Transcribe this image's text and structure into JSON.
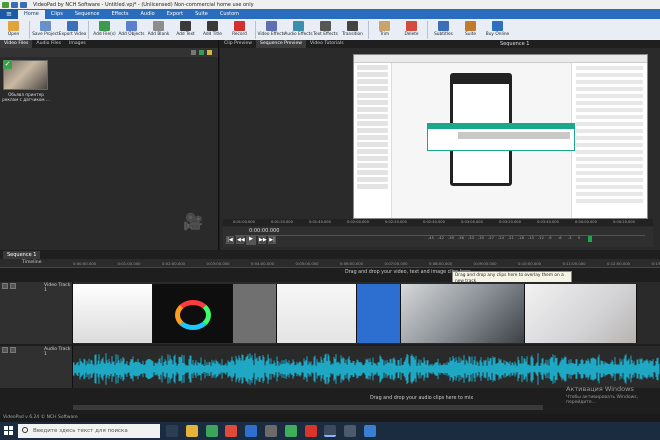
{
  "window": {
    "title": "VideoPad by NCH Software - Untitled.vpj* - (Unlicensed) Non-commercial home use only"
  },
  "menu": {
    "tabs": [
      "Home",
      "Clips",
      "Sequence",
      "Effects",
      "Audio",
      "Export",
      "Suite",
      "Custom"
    ]
  },
  "ribbon": {
    "buttons": [
      {
        "label": "Open",
        "color": "#e0a43a"
      },
      {
        "label": "Save Project",
        "color": "#6b8fc9"
      },
      {
        "label": "Export Video",
        "color": "#3b6fb8"
      },
      {
        "label": "Add File(s)",
        "color": "#3a9b4c"
      },
      {
        "label": "Add Objects",
        "color": "#5a7fd0"
      },
      {
        "label": "Add Blank",
        "color": "#8d8d8d"
      },
      {
        "label": "Add Text",
        "color": "#3a3a3a"
      },
      {
        "label": "Add Title",
        "color": "#3a3a3a"
      },
      {
        "label": "Record",
        "color": "#d0312d"
      },
      {
        "label": "Video Effects",
        "color": "#5f6fb0"
      },
      {
        "label": "Audio Effects",
        "color": "#3a8fb0"
      },
      {
        "label": "Text Effects",
        "color": "#555555"
      },
      {
        "label": "Transition",
        "color": "#444444"
      },
      {
        "label": "Trim",
        "color": "#c9a36b"
      },
      {
        "label": "Delete",
        "color": "#d24b3c"
      },
      {
        "label": "Subtitles",
        "color": "#3a6fb8"
      },
      {
        "label": "Suite",
        "color": "#c07b2c"
      },
      {
        "label": "Buy Online",
        "color": "#2f6fc0"
      }
    ]
  },
  "left_panel": {
    "tabs": [
      "Video Files",
      "Audio Files",
      "Images"
    ],
    "clip_label": "Обьявл принтер реклам с датчиком ..."
  },
  "preview": {
    "tabs": [
      "Clip Preview",
      "Sequence Preview",
      "Video Tutorials"
    ],
    "sequence_label": "Sequence 1",
    "timecode": "0:00:00.000",
    "ruler_ticks": [
      "0:01:00.000",
      "0:01:20.000",
      "0:01:40.000",
      "0:02:00.000",
      "0:02:20.000",
      "0:02:40.000",
      "0:03:00.000",
      "0:03:20.000",
      "0:03:40.000",
      "0:04:00.000",
      "0:04:20.000"
    ],
    "meter_ticks": [
      "-45",
      "-42",
      "-39",
      "-36",
      "-33",
      "-30",
      "-27",
      "-24",
      "-21",
      "-18",
      "-15",
      "-12",
      "-9",
      "-6",
      "-3",
      "0"
    ],
    "controls": [
      "|◀",
      "◀◀",
      "▶",
      "▶▶",
      "▶|"
    ]
  },
  "timeline": {
    "tab": "Sequence 1",
    "ruler_label": "Timeline",
    "ticks": [
      "0:00:00.000",
      "0:01:00.000",
      "0:02:00.000",
      "0:03:00.000",
      "0:04:00.000",
      "0:05:00.000",
      "0:06:00.000",
      "0:07:00.000",
      "0:08:00.000",
      "0:09:00.000",
      "0:10:00.000",
      "0:11:00.000",
      "0:12:00.000",
      "0:13:00.000"
    ],
    "drop_hint": "Drag and drop your video, text and image clips here",
    "tooltip": "Drag and drop any clips here to overlay them on a new track",
    "video_track": "Video Track 1",
    "audio_track": "Audio Track 1",
    "audio_hint": "Drag and drop your audio clips here to mix"
  },
  "watermark": {
    "line1": "Активация Windows",
    "line2": "Чтобы активировать Windows, перейдите..."
  },
  "status": {
    "text": "VideoPad v 6.24 © NCH Software"
  },
  "taskbar": {
    "search_placeholder": "Введите здесь текст для поиска"
  }
}
